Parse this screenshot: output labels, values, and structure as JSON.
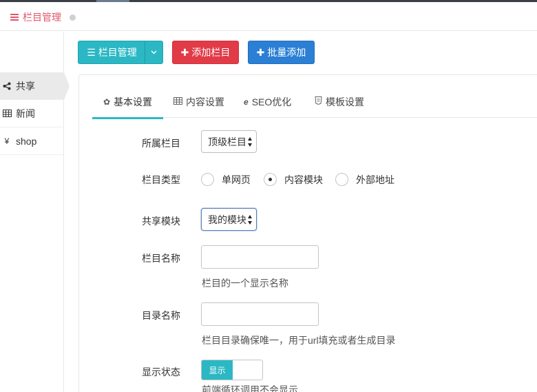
{
  "header": {
    "title": "栏目管理"
  },
  "sidebar": {
    "items": [
      {
        "label": "共享",
        "icon": "share-icon"
      },
      {
        "label": "新闻",
        "icon": "table-icon"
      },
      {
        "label": "shop",
        "icon": "yen-icon"
      }
    ]
  },
  "toolbar": {
    "category_manage": "栏目管理",
    "add_category": "添加栏目",
    "batch_add": "批量添加"
  },
  "tabs": [
    {
      "label": "基本设置",
      "icon": "gear-icon"
    },
    {
      "label": "内容设置",
      "icon": "table-icon"
    },
    {
      "label": "SEO优化",
      "icon": "ie-icon"
    },
    {
      "label": "模板设置",
      "icon": "html5-icon"
    }
  ],
  "form": {
    "parent": {
      "label": "所属栏目",
      "value": "顶级栏目"
    },
    "type": {
      "label": "栏目类型",
      "options": [
        "单网页",
        "内容模块",
        "外部地址"
      ],
      "selected": "内容模块"
    },
    "shared_module": {
      "label": "共享模块",
      "value": "我的模块"
    },
    "name": {
      "label": "栏目名称",
      "value": "",
      "help": "栏目的一个显示名称"
    },
    "dir": {
      "label": "目录名称",
      "value": "",
      "help": "栏目目录确保唯一，用于url填充或者生成目录"
    },
    "display": {
      "label": "显示状态",
      "toggle_label": "显示",
      "help": "前端循环调用不会显示"
    }
  },
  "colors": {
    "brand": "#e0566a",
    "teal": "#2bb8c4",
    "red": "#e23b48",
    "blue": "#2b7fd4"
  }
}
